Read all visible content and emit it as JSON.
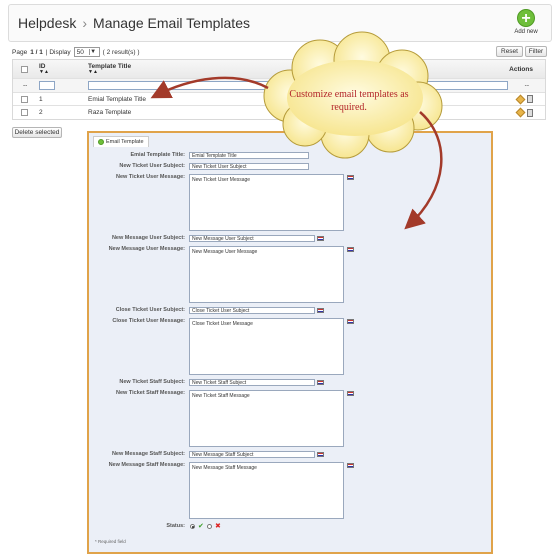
{
  "header": {
    "breadcrumb_root": "Helpdesk",
    "breadcrumb_sep": "›",
    "page_title": "Manage Email Templates",
    "add_new_label": "Add new"
  },
  "pager": {
    "page_prefix": "Page",
    "page_value": "1 / 1",
    "display_label": "| Display",
    "display_value": "50",
    "results": "( 2 result(s) )"
  },
  "toolbar": {
    "reset_label": "Reset",
    "filter_label": "Filter"
  },
  "table": {
    "columns": {
      "id": "ID",
      "title": "Template Title",
      "actions": "Actions"
    },
    "filter_dash_left": "--",
    "filter_dash_right": "--",
    "rows": [
      {
        "id": "1",
        "title": "Emial Template Title"
      },
      {
        "id": "2",
        "title": "Raza Template"
      }
    ]
  },
  "delete_selected_label": "Delete selected",
  "callout": {
    "text": "Customize email templates as required."
  },
  "form": {
    "tab_label": "Email Template",
    "fields": {
      "template_title": {
        "label": "Emial Template Title:",
        "value": "Emial Template Title"
      },
      "new_ticket_user_subject": {
        "label": "New Ticket User Subject:",
        "value": "New Ticket User Subject"
      },
      "new_ticket_user_message": {
        "label": "New Ticket User Message:",
        "value": "New Ticket User Message"
      },
      "new_message_user_subject": {
        "label": "New Message User Subject:",
        "value": "New Message User Subject"
      },
      "new_message_user_message": {
        "label": "New Message User Message:",
        "value": "New Message User Message"
      },
      "close_ticket_user_subject": {
        "label": "Close Ticket User Subject:",
        "value": "Close Ticket User Subject"
      },
      "close_ticket_user_message": {
        "label": "Close Ticket User Message:",
        "value": "Close Ticket User Message"
      },
      "new_ticket_staff_subject": {
        "label": "New Ticket Staff Subject:",
        "value": "New Ticket Staff Subject"
      },
      "new_ticket_staff_message": {
        "label": "New Ticket Staff Message:",
        "value": "New Ticket Staff Message"
      },
      "new_message_staff_subject": {
        "label": "New Message Staff Subject:",
        "value": "New Message Staff Subject"
      },
      "new_message_staff_message": {
        "label": "New Message Staff Message:",
        "value": "New Message Staff Message"
      }
    },
    "status_label": "Status:",
    "required_note": "* Required field"
  },
  "colors": {
    "panel_border": "#e0a34a",
    "callout_text": "#b3262a",
    "arrow": "#a33a2a",
    "add_green": "#6fbf3b"
  }
}
